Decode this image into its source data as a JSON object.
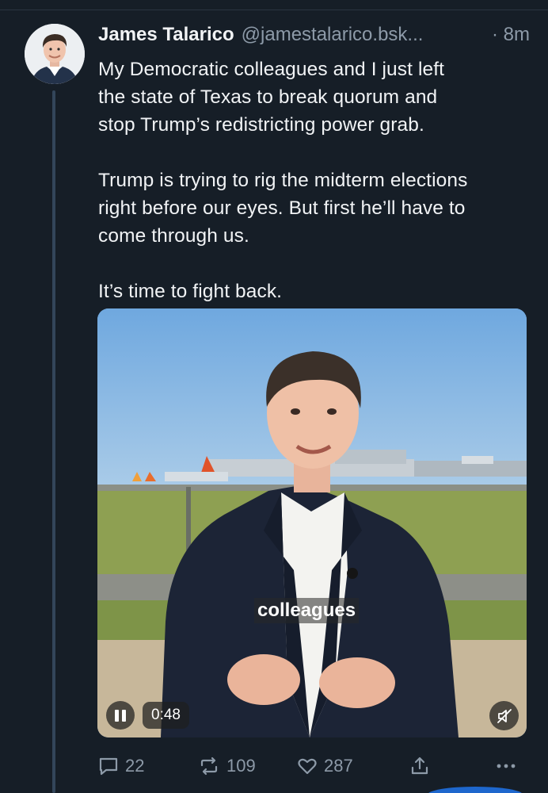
{
  "post": {
    "author_name": "James Talarico",
    "handle": "@jamestalarico.bsk...",
    "timestamp": "· 8m",
    "paragraphs": [
      "My Democratic colleagues and I just left\nthe state of Texas to break quorum and\nstop Trump’s redistricting power grab.",
      "Trump is trying to rig the midterm elections\nright before our eyes. But first he’ll have to\ncome through us.",
      "It’s time to fight back."
    ]
  },
  "video": {
    "caption": "colleagues",
    "elapsed": "0:48",
    "controls": {
      "pause_icon": "pause-icon",
      "mute_icon": "speaker-muted-icon"
    }
  },
  "actions": {
    "reply_count": "22",
    "repost_count": "109",
    "like_count": "287",
    "icons": [
      "reply-icon",
      "repost-icon",
      "like-icon",
      "share-icon",
      "more-icon"
    ]
  },
  "colors": {
    "background": "#161e27",
    "text_primary": "#f1f3f5",
    "text_secondary": "#8d9aa8",
    "thread_line": "#33465a"
  }
}
